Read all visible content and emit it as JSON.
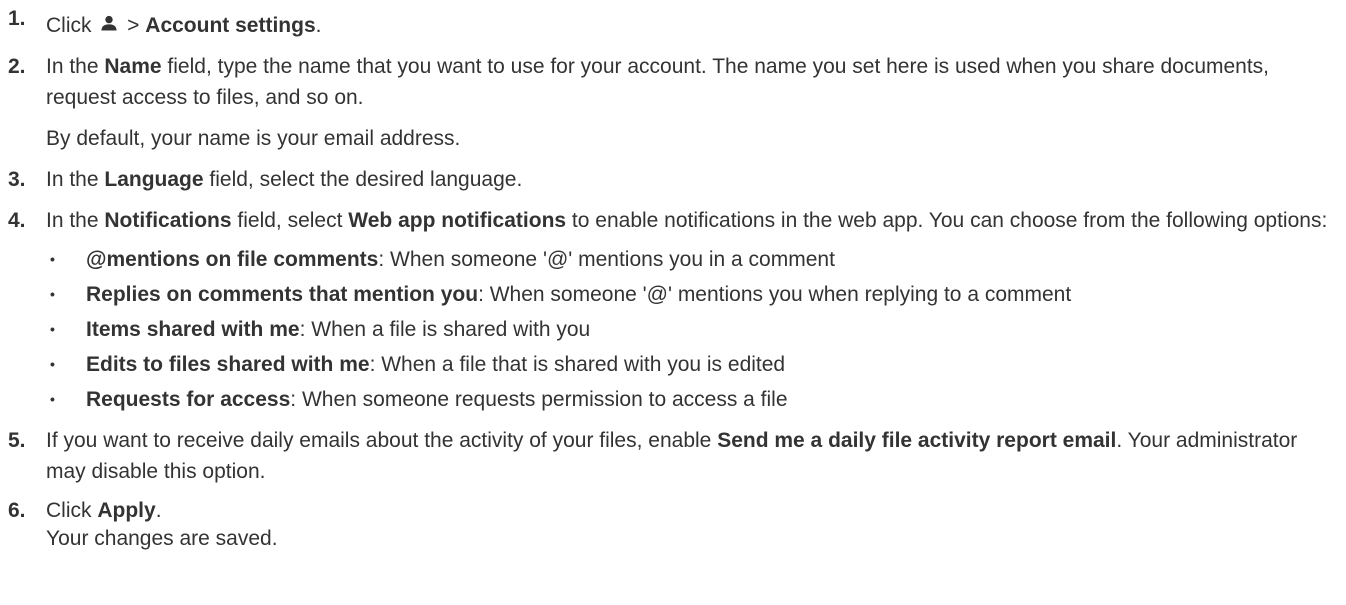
{
  "steps": [
    {
      "num": "1.",
      "text_before": "Click",
      "icon": "user-icon",
      "text_sep": " > ",
      "bold": "Account settings",
      "text_after": "."
    },
    {
      "num": "2.",
      "text_before": "In the ",
      "bold": "Name",
      "text_after": " field, type the name that you want to use for your account. The name you set here is used when you share documents, request access to files, and so on.",
      "note": "By default, your name is your email address."
    },
    {
      "num": "3.",
      "text_before": "In the ",
      "bold": "Language",
      "text_after": " field, select the desired language."
    },
    {
      "num": "4.",
      "text_before": "In the ",
      "bold": "Notifications",
      "text_middle": " field, select ",
      "bold2": "Web app notifications",
      "text_after": " to enable notifications in the web app. You can choose from the following options:",
      "options": [
        {
          "bold": "@mentions on file comments",
          "text": ": When someone '@' mentions you in a comment"
        },
        {
          "bold": "Replies on comments that mention you",
          "text": ": When someone '@' mentions you when replying to a comment"
        },
        {
          "bold": "Items shared with me",
          "text": ": When a file is shared with you"
        },
        {
          "bold": "Edits to files shared with me",
          "text": ": When a file that is shared with you is edited"
        },
        {
          "bold": "Requests for access",
          "text": ": When someone requests permission to access a file"
        }
      ]
    },
    {
      "num": "5.",
      "text_before": "If you want to receive daily emails about the activity of your files, enable ",
      "bold": "Send me a daily file activity report email",
      "text_after": ". Your administrator may disable this option."
    },
    {
      "num": "6.",
      "text_before": "Click ",
      "bold": "Apply",
      "text_after": ".",
      "result": "Your changes are saved."
    }
  ],
  "bullet": "•",
  "colors": {
    "text": "#333333",
    "icon": "#333333"
  }
}
